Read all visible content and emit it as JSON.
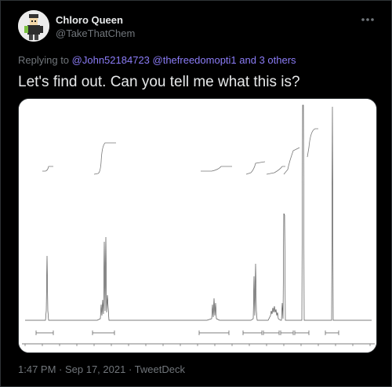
{
  "author": {
    "display_name": "Chloro Queen",
    "handle": "@TakeThatChem"
  },
  "reply": {
    "prefix": "Replying to",
    "mentions": "@John52184723 @thefreedomopti1 and 3 others"
  },
  "text": "Let's find out. Can you tell me what this is?",
  "footer": {
    "time": "1:47 PM",
    "sep1": " · ",
    "date": "Sep 17, 2021",
    "sep2": " · ",
    "client": "TweetDeck"
  },
  "more_icon": "more-options-icon",
  "colors": {
    "background": "#000000",
    "text": "#e7e9ea",
    "secondary": "#71767b",
    "mention": "#8b7cf7"
  }
}
